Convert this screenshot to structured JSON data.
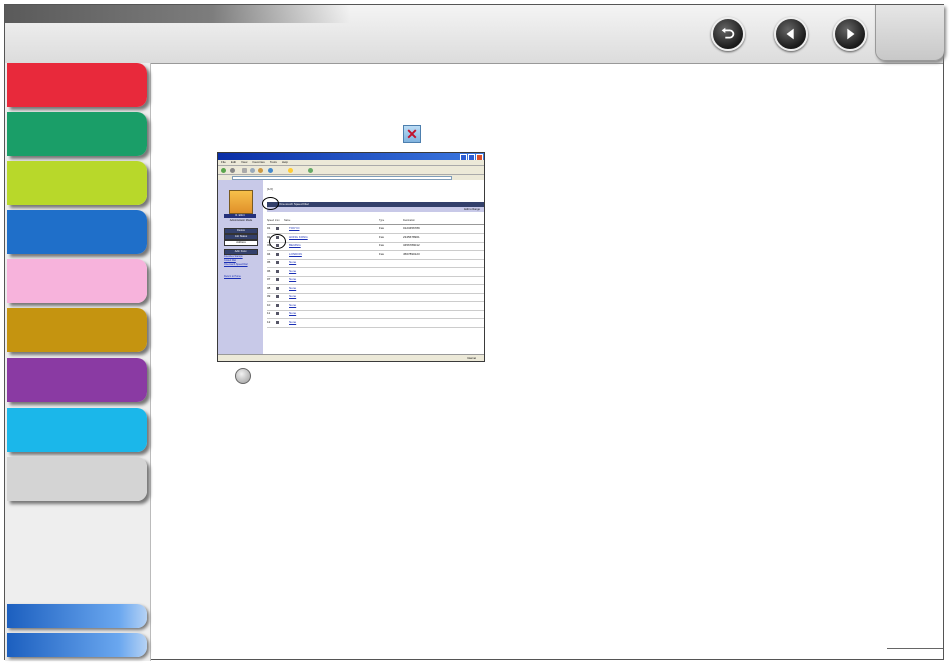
{
  "window": {
    "navigation": [
      {
        "name": "back-icon"
      },
      {
        "name": "previous-page-icon"
      },
      {
        "name": "next-page-icon"
      }
    ]
  },
  "sidebar": {
    "tabs": [
      {
        "color": "#e8293b"
      },
      {
        "color": "#1a9e68"
      },
      {
        "color": "#b8d82a"
      },
      {
        "color": "#1f6fc9"
      },
      {
        "color": "#f7b3dc"
      },
      {
        "color": "#c59410"
      },
      {
        "color": "#8a3aa3"
      },
      {
        "color": "#1bb7ea"
      },
      {
        "color": "#d4d4d4"
      }
    ]
  },
  "screenshot": {
    "menu": [
      "File",
      "Edit",
      "View",
      "Favorites",
      "Tools",
      "Help"
    ],
    "left_panel": {
      "logo_label": "R. Elfort",
      "admin_label": "Administrator Mode",
      "buttons": [
        {
          "label": "Device",
          "bg": "#33406b",
          "fg": "#ffffff"
        },
        {
          "label": "Job Status",
          "bg": "#33406b",
          "fg": "#ffffff"
        },
        {
          "label": "Address",
          "bg": "#ffffff",
          "fg": "#111111"
        },
        {
          "label": "Add. Func.",
          "bg": "#33406b",
          "fg": "#ffffff"
        }
      ],
      "links": [
        "Favorites Stamps",
        "Coded Dial",
        "One-touch Speed Dial",
        "Return to Home"
      ]
    },
    "page_title": "[1/2]",
    "section_title": "One-touch Speed Dial",
    "subbar_text": "Edit to Range",
    "table_headers": [
      "Speed",
      "Icon",
      "Name",
      "Type",
      "Destination"
    ],
    "rows": [
      {
        "num": "01",
        "name": "TOKYO",
        "type": "Fax",
        "dest": "0123456789"
      },
      {
        "num": "02",
        "name": "HONG KONG",
        "type": "Fax",
        "dest": "2345678901"
      },
      {
        "num": "03",
        "name": "BEIJING",
        "type": "Fax",
        "dest": "3456789012"
      },
      {
        "num": "04",
        "name": "LONDON",
        "type": "Fax",
        "dest": "4567890123"
      },
      {
        "num": "05",
        "name": "None",
        "type": "",
        "dest": ""
      },
      {
        "num": "06",
        "name": "None",
        "type": "",
        "dest": ""
      },
      {
        "num": "07",
        "name": "None",
        "type": "",
        "dest": ""
      },
      {
        "num": "08",
        "name": "None",
        "type": "",
        "dest": ""
      },
      {
        "num": "09",
        "name": "None",
        "type": "",
        "dest": ""
      },
      {
        "num": "10",
        "name": "None",
        "type": "",
        "dest": ""
      },
      {
        "num": "11",
        "name": "None",
        "type": "",
        "dest": ""
      },
      {
        "num": "12",
        "name": "None",
        "type": "",
        "dest": ""
      }
    ],
    "status_text": "Internet"
  }
}
